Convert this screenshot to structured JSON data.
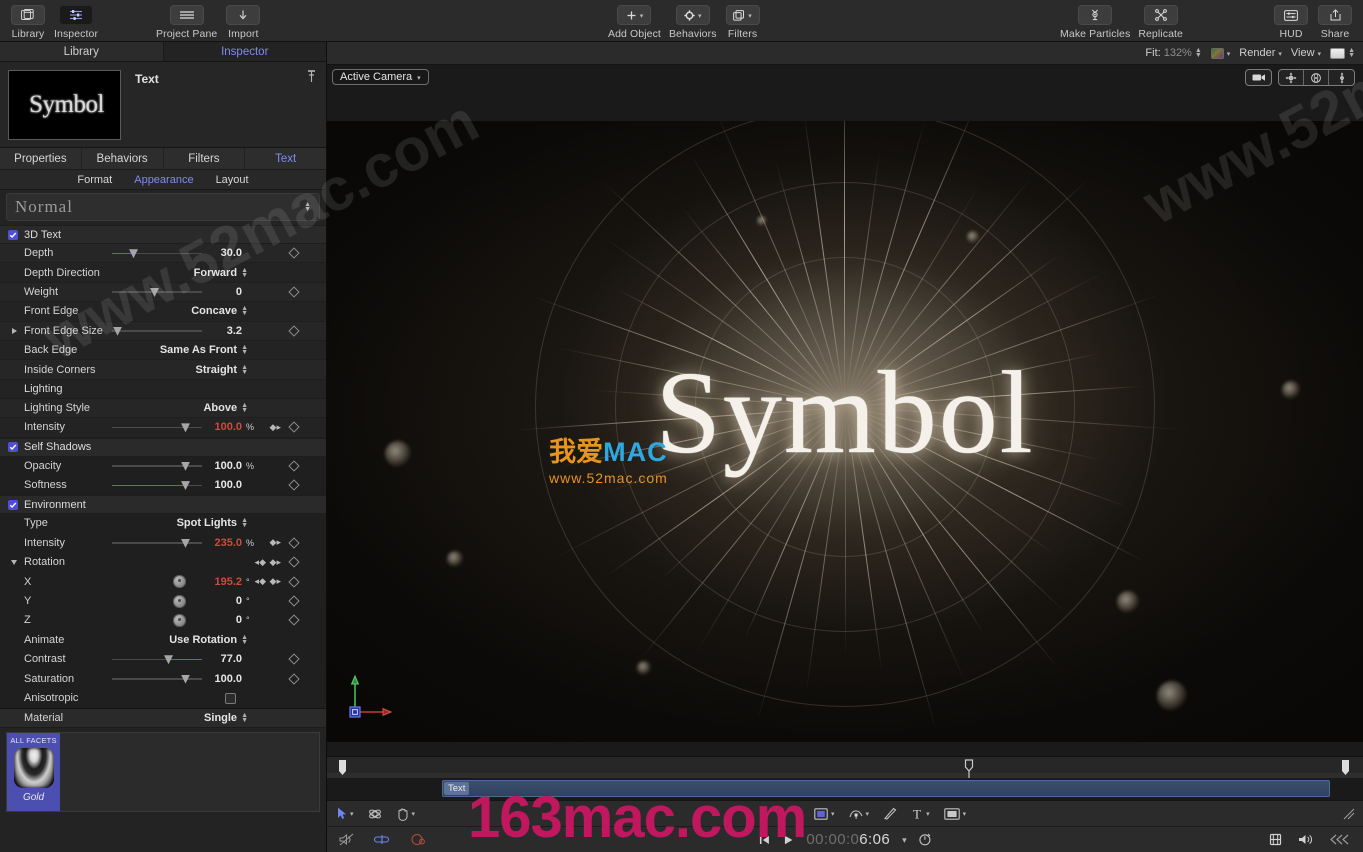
{
  "toolbar": {
    "left": [
      {
        "label": "Library",
        "icon": "library-icon",
        "active": false
      },
      {
        "label": "Inspector",
        "icon": "inspector-sliders-icon",
        "active": true
      }
    ],
    "center_left": [
      {
        "label": "Project Pane",
        "icon": "project-pane-icon"
      },
      {
        "label": "Import",
        "icon": "import-down-arrow-icon"
      }
    ],
    "center": [
      {
        "label": "Add Object",
        "icon": "plus-icon"
      },
      {
        "label": "Behaviors",
        "icon": "gear-circle-icon"
      },
      {
        "label": "Filters",
        "icon": "filters-stack-icon"
      }
    ],
    "right_group": [
      {
        "label": "Make Particles",
        "icon": "particles-icon"
      },
      {
        "label": "Replicate",
        "icon": "replicate-nodes-icon"
      }
    ],
    "right": [
      {
        "label": "HUD",
        "icon": "hud-icon"
      },
      {
        "label": "Share",
        "icon": "share-upload-icon"
      }
    ]
  },
  "inspector": {
    "panel_tabs": [
      {
        "label": "Library",
        "selected": false
      },
      {
        "label": "Inspector",
        "selected": true
      }
    ],
    "preview": {
      "title": "Text",
      "thumbnail_text": "Symbol",
      "pin_icon": "pin-icon"
    },
    "object_tabs": [
      {
        "label": "Properties",
        "selected": false
      },
      {
        "label": "Behaviors",
        "selected": false
      },
      {
        "label": "Filters",
        "selected": false
      },
      {
        "label": "Text",
        "selected": true
      }
    ],
    "sub_tabs": [
      {
        "label": "Format",
        "selected": false
      },
      {
        "label": "Appearance",
        "selected": true
      },
      {
        "label": "Layout",
        "selected": false
      }
    ],
    "style_preset": "Normal",
    "groups": [
      {
        "name": "3D Text",
        "checkbox": true,
        "rows": [
          {
            "label": "Depth",
            "type": "slider",
            "value": "30.0",
            "fill": 0.22,
            "knob": 0.22,
            "keyframe": true
          },
          {
            "label": "Depth Direction",
            "type": "popup",
            "value": "Forward"
          },
          {
            "label": "Weight",
            "type": "slider",
            "value": "0",
            "fill": 0,
            "knob": 0.42,
            "keyframe": true
          },
          {
            "label": "Front Edge",
            "type": "popup",
            "value": "Concave"
          },
          {
            "label": "Front Edge Size",
            "type": "slider",
            "value": "3.2",
            "fill": 0.02,
            "knob": 0.04,
            "keyframe": true,
            "disclosure": "closed"
          },
          {
            "label": "Back Edge",
            "type": "popup",
            "value": "Same As Front"
          },
          {
            "label": "Inside Corners",
            "type": "popup",
            "value": "Straight"
          }
        ]
      },
      {
        "name": "Lighting",
        "checkbox": null,
        "rows": [
          {
            "label": "Lighting Style",
            "type": "popup",
            "value": "Above"
          },
          {
            "label": "Intensity",
            "type": "slider",
            "value": "100.0",
            "unit": "%",
            "fill": 0,
            "knob": 0.78,
            "keyframe": true,
            "animated": true
          }
        ]
      },
      {
        "name": "Self Shadows",
        "checkbox": true,
        "rows": [
          {
            "label": "Opacity",
            "type": "slider",
            "value": "100.0",
            "unit": "%",
            "fill": 0,
            "knob": 0.78,
            "keyframe": true
          },
          {
            "label": "Softness",
            "type": "slider",
            "value": "100.0",
            "fill": 0.8,
            "knob": 0.8,
            "keyframe": true
          }
        ]
      },
      {
        "name": "Environment",
        "checkbox": true,
        "rows": [
          {
            "label": "Type",
            "type": "popup",
            "value": "Spot Lights"
          },
          {
            "label": "Intensity",
            "type": "slider",
            "value": "235.0",
            "unit": "%",
            "fill": 0,
            "knob": 0.78,
            "keyframe": true,
            "animated": true
          },
          {
            "label": "Rotation",
            "type": "header",
            "disclosure": "open",
            "animated": true,
            "prev": true
          },
          {
            "label": "X",
            "type": "dial",
            "value": "195.2",
            "unit": "°",
            "keyframed": true,
            "animated": true,
            "prev": true
          },
          {
            "label": "Y",
            "type": "dial",
            "value": "0",
            "unit": "°"
          },
          {
            "label": "Z",
            "type": "dial",
            "value": "0",
            "unit": "°"
          },
          {
            "label": "Animate",
            "type": "popup",
            "value": "Use Rotation"
          },
          {
            "label": "Contrast",
            "type": "slider",
            "value": "77.0",
            "fill": 0.62,
            "knob": 0.6,
            "keyframe": true
          },
          {
            "label": "Saturation",
            "type": "slider",
            "value": "100.0",
            "fill": 0,
            "knob": 0.78,
            "keyframe": true
          },
          {
            "label": "Anisotropic",
            "type": "checkbox",
            "checked": false
          }
        ]
      }
    ],
    "material": {
      "label": "Material",
      "value": "Single",
      "chip_caption": "ALL FACETS",
      "chip_name": "Gold"
    }
  },
  "canvas": {
    "fit_label": "Fit:",
    "fit_value": "132%",
    "render_label": "Render",
    "view_label": "View",
    "camera": "Active Camera",
    "artwork_text": "Symbol",
    "camera_icon": "camera-icon",
    "tools": [
      "move-3d-icon",
      "rotate-3d-icon",
      "dolly-3d-icon"
    ]
  },
  "timeline": {
    "clip_label": "Text"
  },
  "transport": {
    "tools": [
      {
        "icon": "select-arrow-icon",
        "has_menu": true
      },
      {
        "icon": "3d-transform-icon",
        "has_menu": false
      },
      {
        "icon": "pan-hand-icon",
        "has_menu": true
      },
      {
        "icon": "shape-rect-icon",
        "has_menu": true
      },
      {
        "icon": "bezier-pen-icon",
        "has_menu": true
      },
      {
        "icon": "paint-stroke-icon",
        "has_menu": false
      },
      {
        "icon": "text-tool-icon",
        "has_menu": true
      },
      {
        "icon": "mask-icon",
        "has_menu": true
      }
    ],
    "left_icons": [
      "audio-mute-icon",
      "loop-icon",
      "record-keyframe-icon"
    ],
    "goto_start_icon": "go-to-start-icon",
    "play_icon": "play-icon",
    "timecode": "00:00:06:06",
    "timecode_dim": "00:00:0",
    "timecode_lit": "6:06",
    "menu_icon": "chevron-down-icon",
    "clock_icon": "project-duration-icon",
    "right_icons": [
      "film-frame-icon",
      "speaker-icon",
      "jog-shuttle-icon"
    ]
  },
  "watermarks": {
    "site_cn": "我爱",
    "site_en": "MAC",
    "site_url": "www.52mac.com",
    "big": "163mac.com",
    "faint": "www.52mac.com"
  },
  "colors": {
    "accent": "#7f8cf0",
    "slider_fill": "#5b5fd8",
    "keyframe_red": "#cf4b3c",
    "checkbox": "#4d4fd4",
    "clip": "#3a4f6e",
    "watermark_orange": "#e8941e",
    "watermark_blue": "#2ea8e0",
    "watermark_pink": "#c0175f"
  }
}
